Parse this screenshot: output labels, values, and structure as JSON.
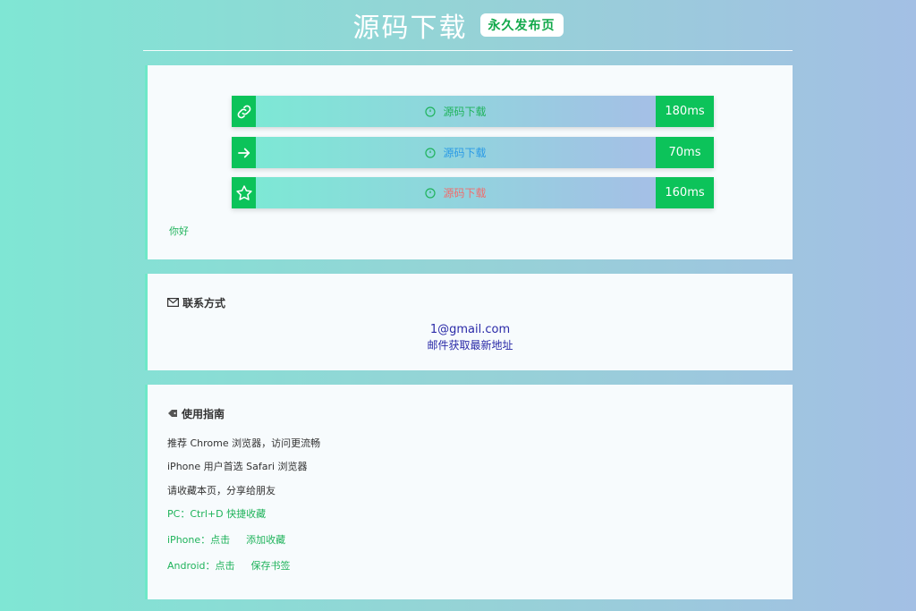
{
  "header": {
    "title": "源码下载",
    "badge": "永久发布页"
  },
  "links": [
    {
      "icon": "link-icon",
      "label": "源码下载",
      "ms": "180ms",
      "color": "#1fb35b"
    },
    {
      "icon": "arrow-right-icon",
      "label": "源码下载",
      "ms": "70ms",
      "color": "#2a9ae6"
    },
    {
      "icon": "star-icon",
      "label": "源码下载",
      "ms": "160ms",
      "color": "#f06d6d"
    }
  ],
  "greeting": "你好",
  "contact": {
    "title": "联系方式",
    "email": "1@gmail.com",
    "note": "邮件获取最新地址"
  },
  "guide": {
    "title": "使用指南",
    "lines": [
      "推荐 Chrome 浏览器，访问更流畅",
      "iPhone 用户首选 Safari 浏览器",
      "请收藏本页，分享给朋友",
      "PC：Ctrl+D 快捷收藏"
    ],
    "iphone_label": "iPhone：点击",
    "iphone_action": "添加收藏",
    "android_label": "Android：点击",
    "android_action": "保存书签"
  },
  "colors": {
    "accent": "#0cc35a",
    "text_green": "#1fb35b",
    "contact_blue": "#2a2aa8"
  }
}
